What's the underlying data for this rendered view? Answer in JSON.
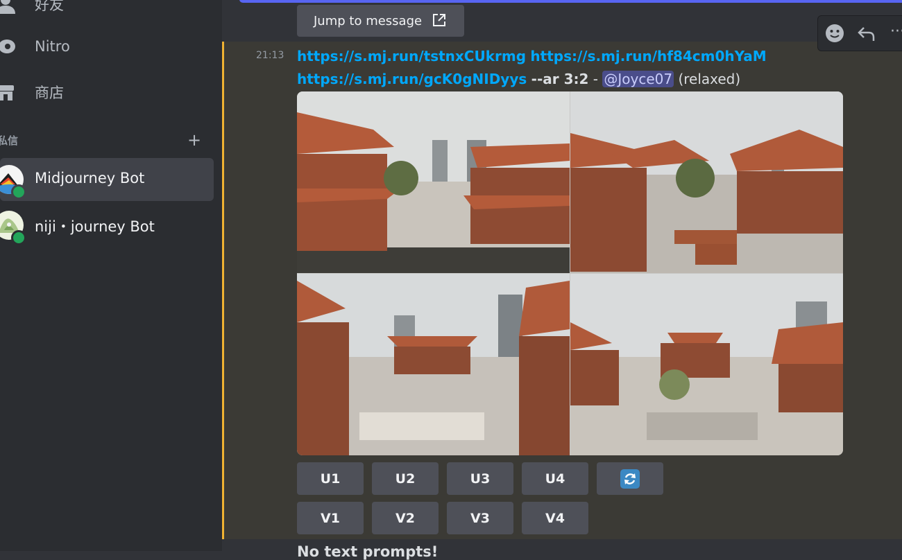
{
  "sidebar": {
    "nav": [
      {
        "label": "好友",
        "icon": "friends-icon"
      },
      {
        "label": "Nitro",
        "icon": "nitro-icon"
      },
      {
        "label": "商店",
        "icon": "shop-icon"
      }
    ],
    "dm_header": "私信",
    "dm_add": "+",
    "dms": [
      {
        "name": "Midjourney Bot",
        "status": "online"
      },
      {
        "name": "niji・journey Bot",
        "status": "online"
      }
    ]
  },
  "jump": {
    "label": "Jump to message",
    "icon": "external-link-icon"
  },
  "toolbar": {
    "icons": [
      "emoji-icon",
      "reply-icon",
      "more-icon"
    ],
    "more_label": "···"
  },
  "message": {
    "timestamp": "21:13",
    "links": [
      "https://s.mj.run/tstnxCUkrmg",
      "https://s.mj.run/hf84cm0hYaM",
      "https://s.mj.run/gcK0gNIDyys"
    ],
    "flags": "--ar 3:2",
    "separator": "-",
    "mention": "@Joyce07",
    "mode": "(relaxed)",
    "image_alt": "2x2 grid of traditional Chinese-style red-roofed pavilion courtyards with modern high-rise towers in background under cloudy sky"
  },
  "buttons": {
    "upscale": [
      "U1",
      "U2",
      "U3",
      "U4"
    ],
    "variation": [
      "V1",
      "V2",
      "V3",
      "V4"
    ],
    "reroll_icon": "refresh-icon"
  },
  "next_message": "No text prompts!",
  "colors": {
    "accent": "#f0b232",
    "link": "#00a8fc",
    "online": "#23a55a",
    "blurple": "#5865f2"
  }
}
